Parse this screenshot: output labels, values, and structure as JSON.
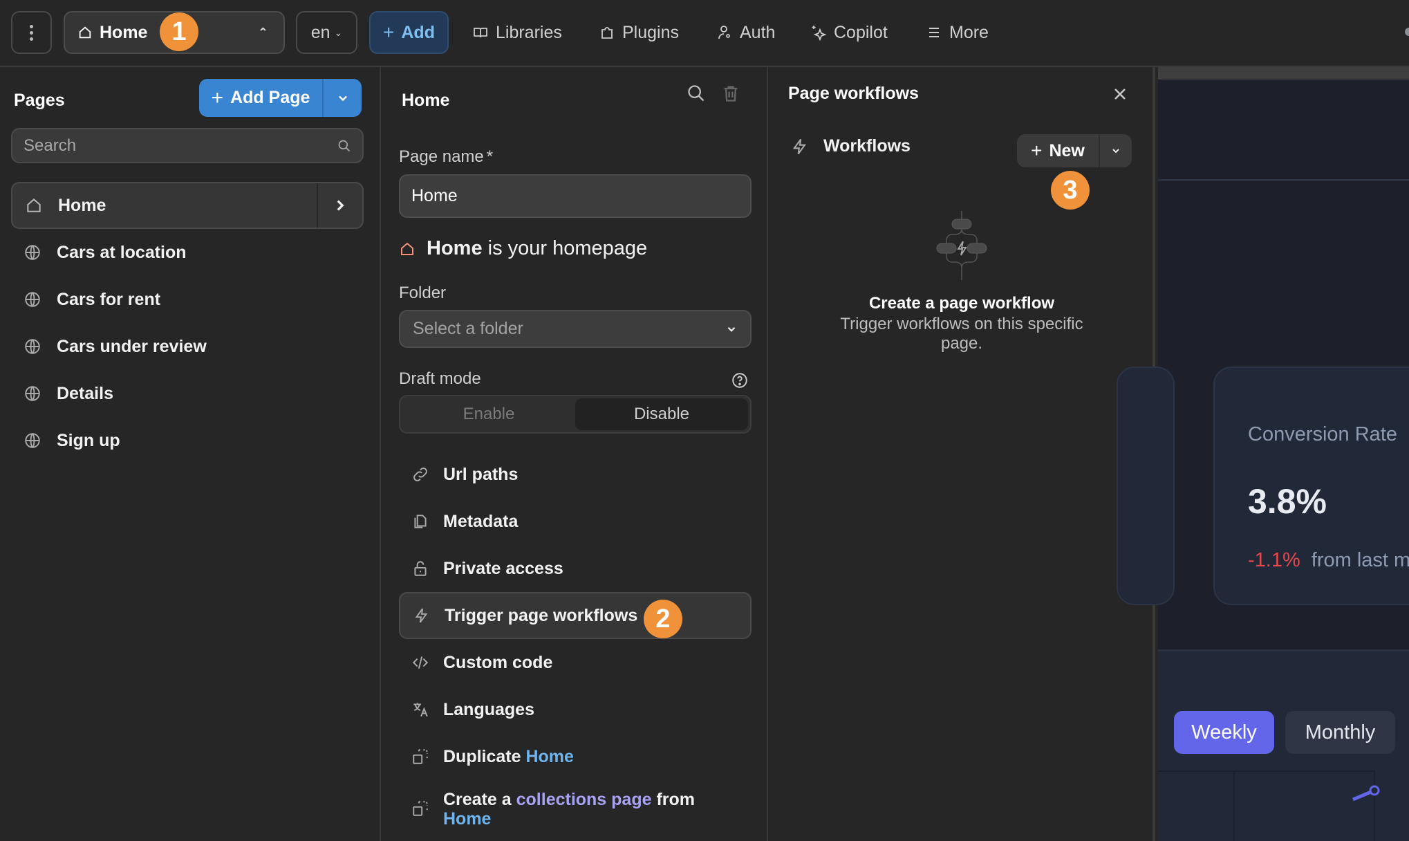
{
  "topbar": {
    "menu_icon": "kebab-vertical-icon",
    "page_selector": {
      "icon": "home-icon",
      "label": "Home",
      "caret": "chevron-up-icon"
    },
    "language": {
      "value": "en",
      "caret": "chevron-down-icon"
    },
    "add_button": {
      "icon": "plus-icon",
      "label": "Add"
    },
    "nav": [
      {
        "icon": "book-open-icon",
        "label": "Libraries"
      },
      {
        "icon": "puzzle-icon",
        "label": "Plugins"
      },
      {
        "icon": "user-key-icon",
        "label": "Auth"
      },
      {
        "icon": "sparkles-icon",
        "label": "Copilot"
      },
      {
        "icon": "menu-lines-icon",
        "label": "More"
      }
    ]
  },
  "annotations": [
    {
      "number": "1",
      "target": "page-selector"
    },
    {
      "number": "2",
      "target": "Trigger page workflows"
    },
    {
      "number": "3",
      "target": "New workflow button"
    }
  ],
  "pages_panel": {
    "title": "Pages",
    "add_page_label": "Add Page",
    "search_placeholder": "Search",
    "pages": [
      {
        "icon": "home-icon",
        "label": "Home",
        "active": true
      },
      {
        "icon": "globe-icon",
        "label": "Cars at location"
      },
      {
        "icon": "globe-icon",
        "label": "Cars for rent"
      },
      {
        "icon": "globe-icon",
        "label": "Cars under review"
      },
      {
        "icon": "globe-icon",
        "label": "Details"
      },
      {
        "icon": "globe-icon",
        "label": "Sign up"
      }
    ]
  },
  "settings_panel": {
    "title": "Home",
    "page_name_label": "Page name",
    "required_mark": "*",
    "page_name_value": "Home",
    "homepage_note": {
      "bold": "Home",
      "rest": "is your homepage"
    },
    "folder_label": "Folder",
    "folder_placeholder": "Select a folder",
    "draft_mode_label": "Draft mode",
    "draft_mode_options": [
      "Enable",
      "Disable"
    ],
    "draft_mode_selected": "Disable",
    "menu": [
      {
        "icon": "link-icon",
        "label": "Url paths"
      },
      {
        "icon": "copy-pages-icon",
        "label": "Metadata"
      },
      {
        "icon": "lock-open-icon",
        "label": "Private access"
      },
      {
        "icon": "lightning-icon",
        "label": "Trigger page workflows",
        "active": true
      },
      {
        "icon": "code-icon",
        "label": "Custom code"
      },
      {
        "icon": "translate-icon",
        "label": "Languages"
      },
      {
        "icon": "duplicate-icon",
        "label_prefix": "Duplicate",
        "label_link": "Home"
      },
      {
        "icon": "duplicate-icon",
        "label_prefix": "Create a",
        "label_link_purple": "collections page",
        "label_mid": "from",
        "label_link": "Home"
      }
    ]
  },
  "workflows_panel": {
    "title": "Page workflows",
    "section_label": "Workflows",
    "new_label": "New",
    "empty_title": "Create a page workflow",
    "empty_subtitle": "Trigger workflows on this specific page."
  },
  "canvas": {
    "card": {
      "label": "Conversion Rate",
      "value": "3.8%",
      "delta": "-1.1%",
      "delta_suffix": "from last m"
    },
    "toggles": [
      "Weekly",
      "Monthly"
    ],
    "toggle_selected": "Weekly",
    "colors": {
      "accent": "#6366e8",
      "negative": "#e5484d",
      "badge": "#f0923a",
      "primary_button": "#3a85d1"
    }
  }
}
